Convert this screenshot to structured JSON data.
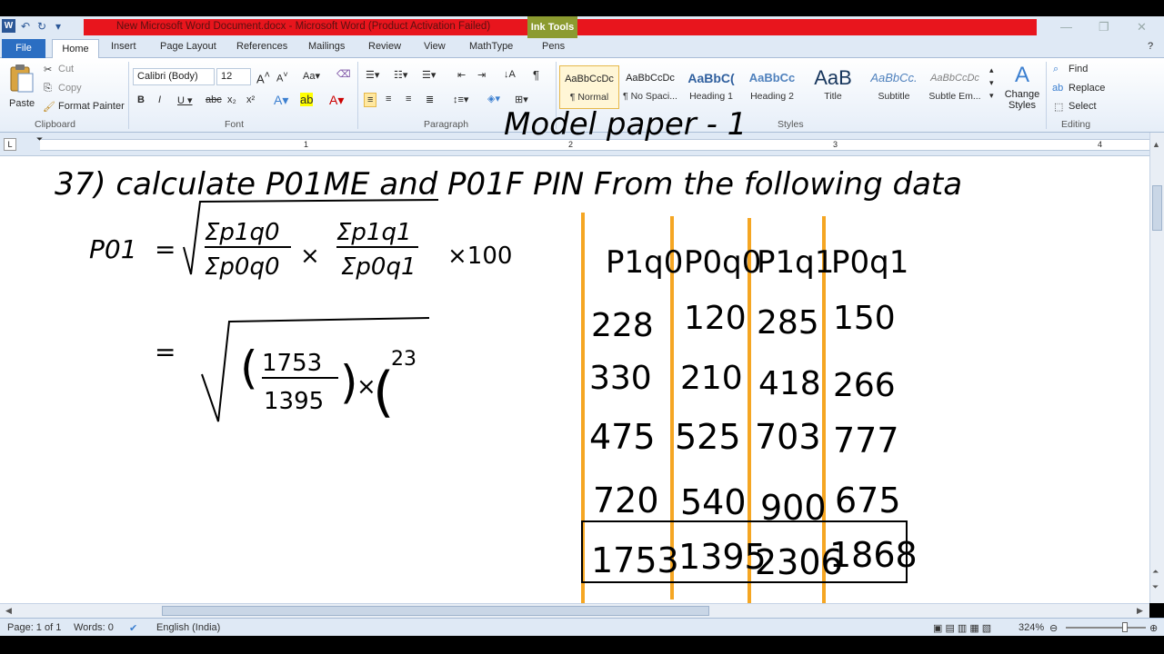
{
  "titlebar": {
    "title": "New Microsoft Word Document.docx  -  Microsoft Word (Product Activation Failed)",
    "contextual_tab": "Ink Tools",
    "accent": "#e8151d"
  },
  "tabs": [
    "File",
    "Home",
    "Insert",
    "Page Layout",
    "References",
    "Mailings",
    "Review",
    "View",
    "MathType",
    "Pens"
  ],
  "clipboard": {
    "paste": "Paste",
    "cut": "Cut",
    "copy": "Copy",
    "format_painter": "Format Painter",
    "label": "Clipboard"
  },
  "font": {
    "family": "Calibri (Body)",
    "size": "12",
    "label": "Font"
  },
  "paragraph": {
    "label": "Paragraph"
  },
  "styles": {
    "items": [
      {
        "sample": "AaBbCcDc",
        "name": "¶ Normal"
      },
      {
        "sample": "AaBbCcDc",
        "name": "¶ No Spaci..."
      },
      {
        "sample": "AaBbC(",
        "name": "Heading 1"
      },
      {
        "sample": "AaBbCc",
        "name": "Heading 2"
      },
      {
        "sample": "AaB",
        "name": "Title"
      },
      {
        "sample": "AaBbCc.",
        "name": "Subtitle"
      },
      {
        "sample": "AaBbCcDc",
        "name": "Subtle Em..."
      }
    ],
    "change_styles": "Change Styles",
    "label": "Styles"
  },
  "editing": {
    "find": "Find",
    "replace": "Replace",
    "select": "Select",
    "label": "Editing"
  },
  "ruler_numbers": [
    "1",
    "2",
    "3",
    "4"
  ],
  "ink": {
    "heading": "Model paper - 1",
    "question": "37) calculate P01ME and P01F PIN From the following data",
    "formula": {
      "lhs": "P01",
      "num1": "Σp1q0",
      "den1": "Σp0q0",
      "num2": "Σp1q1",
      "den2": "Σp0q1",
      "times": "×100"
    },
    "step": {
      "num": "1753",
      "den": "1395",
      "partial": "23"
    },
    "table": {
      "headers": [
        "P1q0",
        "P0q0",
        "P1q1",
        "P0q1"
      ],
      "rows": [
        [
          "228",
          "120",
          "285",
          "150"
        ],
        [
          "330",
          "210",
          "418",
          "266"
        ],
        [
          "475",
          "525",
          "703",
          "777"
        ],
        [
          "720",
          "540",
          "900",
          "675"
        ]
      ],
      "totals": [
        "1753",
        "1395",
        "2306",
        "1868"
      ]
    }
  },
  "status": {
    "page": "Page: 1 of 1",
    "words": "Words: 0",
    "language": "English (India)",
    "zoom": "324%"
  }
}
